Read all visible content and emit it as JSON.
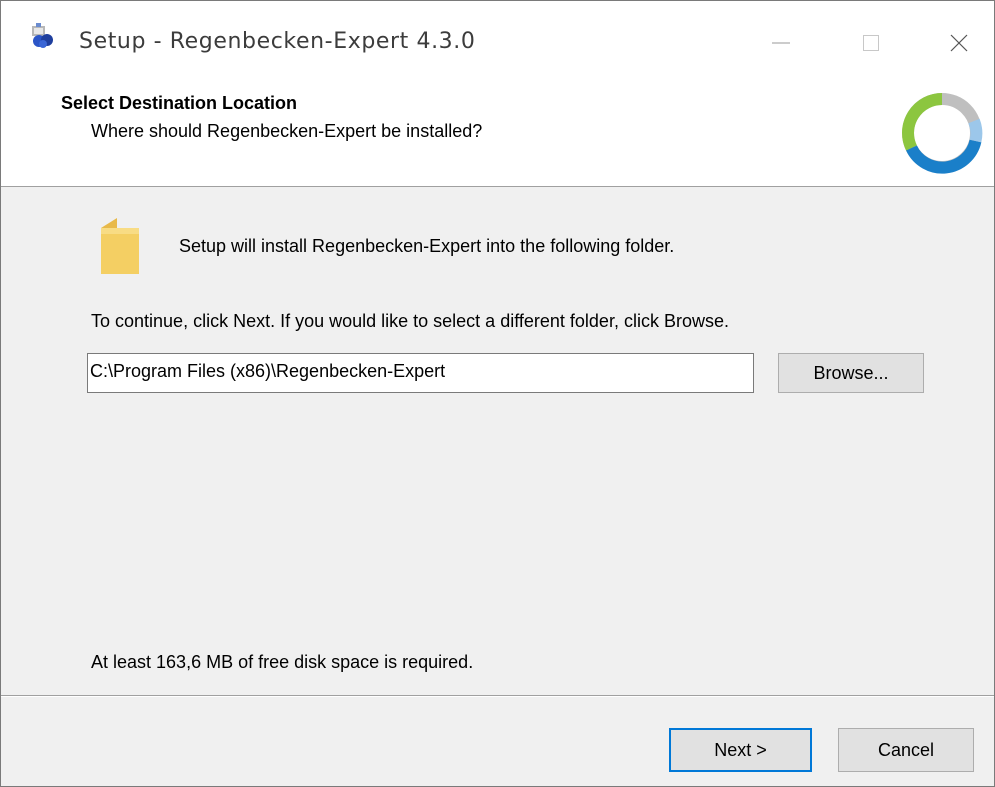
{
  "window": {
    "title": "Setup - Regenbecken-Expert 4.3.0",
    "icon": "setup-app-icon",
    "controls": {
      "minimize": "—",
      "maximize": "☐",
      "close": "✕"
    }
  },
  "header": {
    "title": "Select Destination Location",
    "subtitle": "Where should Regenbecken-Expert be installed?",
    "logo_icon": "installer-ring-logo"
  },
  "body": {
    "folder_icon": "folder-icon",
    "intro": "Setup will install Regenbecken-Expert into the following folder.",
    "instruction": "To continue, click Next. If you would like to select a different folder, click Browse.",
    "path_value": "C:\\Program Files (x86)\\Regenbecken-Expert",
    "browse_label": "Browse...",
    "disk_space": "At least 163,6 MB of free disk space is required."
  },
  "footer": {
    "next_label": "Next >",
    "cancel_label": "Cancel"
  },
  "colors": {
    "focus_border": "#0078d7",
    "logo_green": "#8cc63f",
    "logo_blue": "#1a7fc9",
    "logo_light_blue": "#9cc7ea",
    "logo_gray": "#bfbfbf"
  }
}
